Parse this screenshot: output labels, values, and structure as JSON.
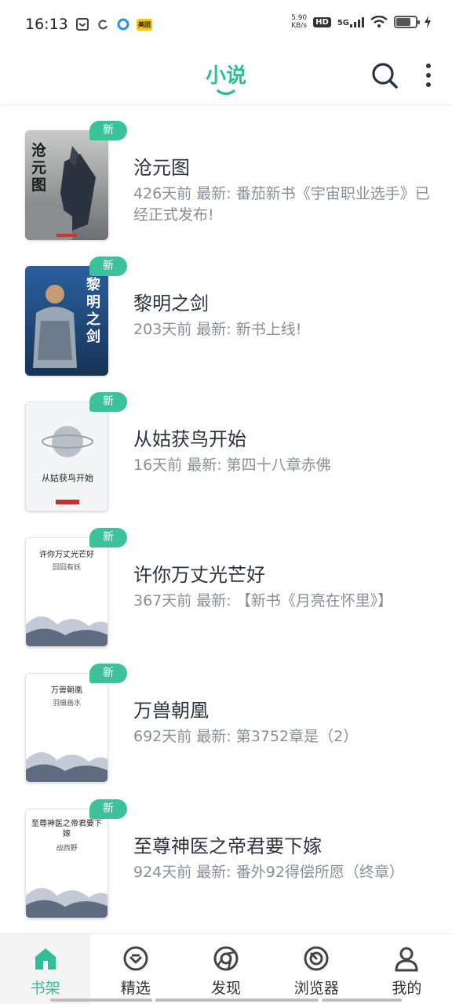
{
  "status_bar": {
    "time": "16:13",
    "net_speed_value": "5.90",
    "net_speed_unit": "KB/s",
    "hd": "HD",
    "network": "5G",
    "battery_level": 0.75,
    "left_icons": [
      "notification-icon",
      "sync-icon",
      "circle-app-icon",
      "meituan-icon"
    ],
    "meituan_label": "美团"
  },
  "header": {
    "title": "小说",
    "search_icon": "search-icon",
    "more_icon": "more-vertical-icon",
    "accent_color": "#2fbf98"
  },
  "books": [
    {
      "title": "沧元图",
      "meta": "426天前 最新: 番茄新书《宇宙职业选手》已经正式发布!",
      "badge": "新",
      "cover_text": "沧元图"
    },
    {
      "title": "黎明之剑",
      "meta": "203天前 最新: 新书上线!",
      "badge": "新",
      "cover_text": "黎明之剑"
    },
    {
      "title": "从姑获鸟开始",
      "meta": "16天前 最新: 第四十八章赤佛",
      "badge": "新",
      "cover_text": "从姑获鸟开始"
    },
    {
      "title": "许你万丈光芒好",
      "meta": "367天前 最新: 【新书《月亮在怀里》】",
      "badge": "新",
      "cover_title": "许你万丈光芒好",
      "cover_author": "囧囧有妖"
    },
    {
      "title": "万兽朝凰",
      "meta": "692天前 最新: 第3752章是（2）",
      "badge": "新",
      "cover_title": "万兽朝凰",
      "cover_author": "羽扇画水"
    },
    {
      "title": "至尊神医之帝君要下嫁",
      "meta": "924天前 最新: 番外92得偿所愿（终章）",
      "badge": "新",
      "cover_title": "至尊神医之帝君要下嫁",
      "cover_author": "战西野"
    }
  ],
  "bottom_nav": [
    {
      "label": "书架",
      "icon": "home-icon",
      "active": true
    },
    {
      "label": "精选",
      "icon": "featured-icon",
      "active": false
    },
    {
      "label": "发现",
      "icon": "discover-icon",
      "active": false
    },
    {
      "label": "浏览器",
      "icon": "browser-icon",
      "active": false
    },
    {
      "label": "我的",
      "icon": "profile-icon",
      "active": false
    }
  ]
}
